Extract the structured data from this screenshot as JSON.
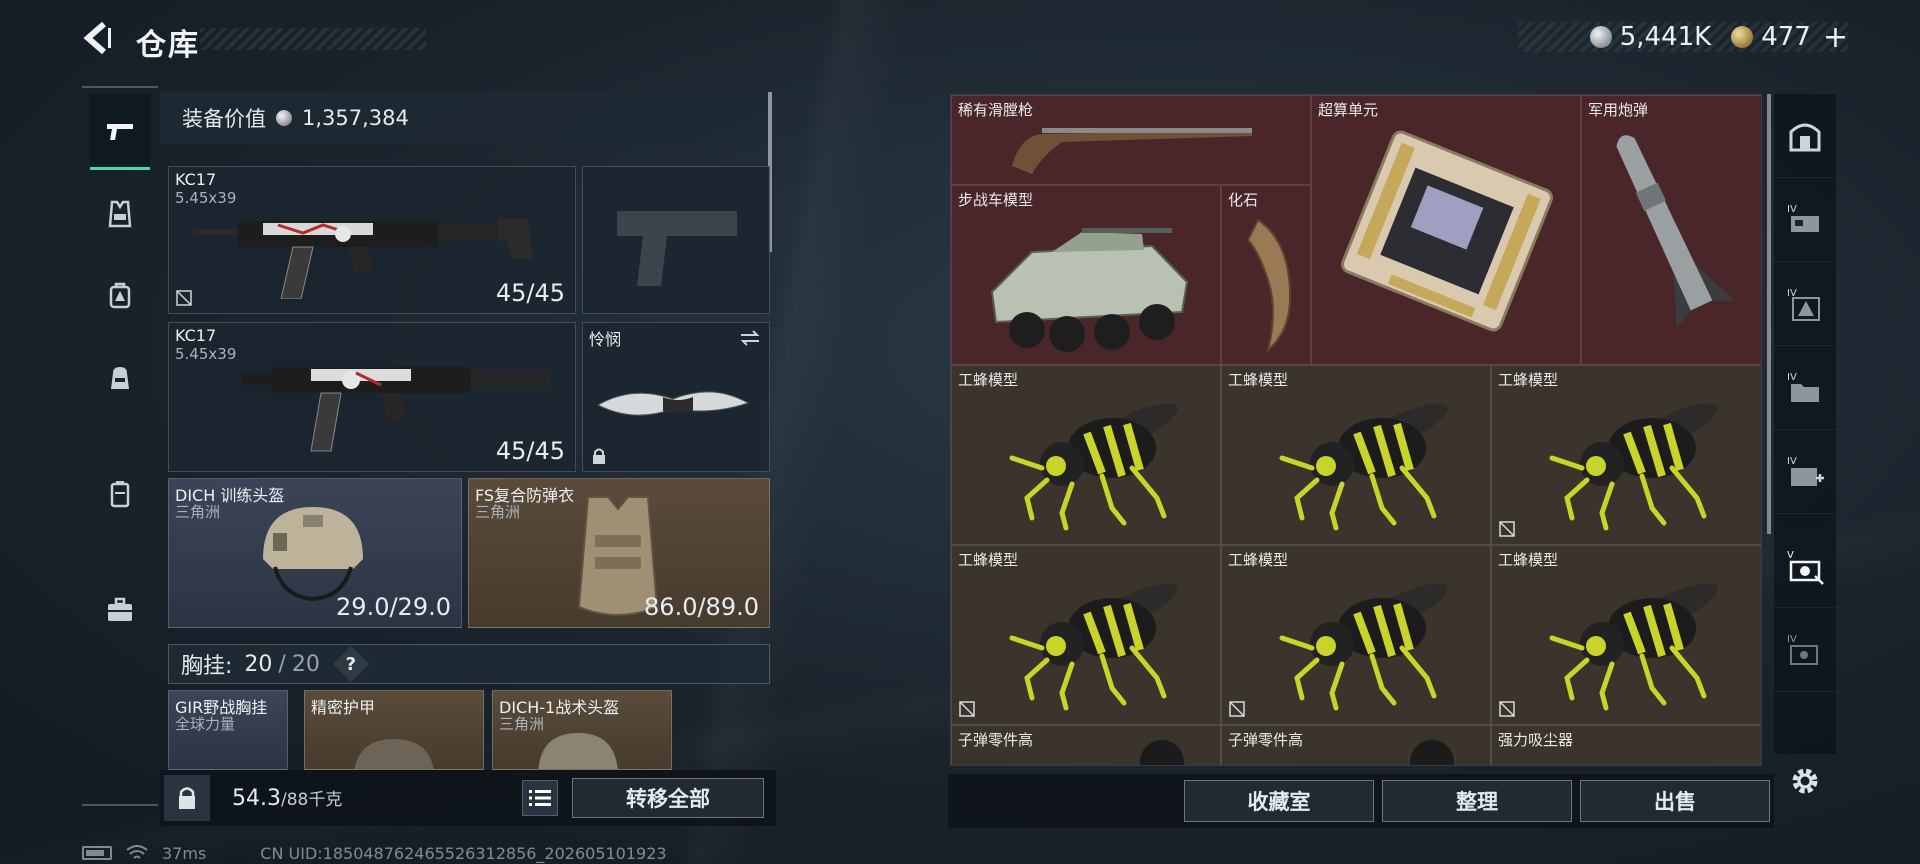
{
  "header": {
    "title": "仓库",
    "currency_silver": "5,441K",
    "currency_gold": "477",
    "add_label": "+"
  },
  "left_nav": {
    "items": [
      "pistol-icon",
      "vest-icon",
      "backpack-lock-icon",
      "pouch-icon",
      "case-icon",
      "toolbox-icon"
    ],
    "active": "pistol-icon"
  },
  "equipment": {
    "value_label": "装备价值",
    "value": "1,357,384",
    "primary_1": {
      "name": "KC17",
      "caliber": "5.45x39",
      "ammo": "45/45"
    },
    "primary_2": {
      "name": "KC17",
      "caliber": "5.45x39",
      "ammo": "45/45"
    },
    "knife": {
      "name": "怜悯"
    },
    "helmet": {
      "name": "DICH 训练头盔",
      "brand": "三角洲",
      "durability": "29.0/29.0"
    },
    "armor": {
      "name": "FS复合防弹衣",
      "brand": "三角洲",
      "durability": "86.0/89.0"
    },
    "rig": {
      "label": "胸挂:",
      "used": "20",
      "sep": "/",
      "capacity": "20",
      "help": "?"
    },
    "rig_items": [
      {
        "name": "GIR野战胸挂",
        "brand": "全球力量"
      },
      {
        "name": "精密护甲",
        "brand": ""
      },
      {
        "name": "DICH-1战术头盔",
        "brand": "三角洲"
      }
    ]
  },
  "bottom_left": {
    "weight_value": "54.3",
    "weight_max": "/88千克",
    "transfer_all": "转移全部"
  },
  "collection": {
    "cells": [
      {
        "id": "shotgun",
        "name": "稀有滑膛枪",
        "color": "red"
      },
      {
        "id": "supercomputer",
        "name": "超算单元",
        "color": "red"
      },
      {
        "id": "shell",
        "name": "军用炮弹",
        "color": "red"
      },
      {
        "id": "ifv",
        "name": "步战车模型",
        "color": "red"
      },
      {
        "id": "fossil",
        "name": "化石",
        "color": "red"
      },
      {
        "id": "bee1",
        "name": "工蜂模型",
        "color": "brown"
      },
      {
        "id": "bee2",
        "name": "工蜂模型",
        "color": "brown"
      },
      {
        "id": "bee3",
        "name": "工蜂模型",
        "color": "brown"
      },
      {
        "id": "bee4",
        "name": "工蜂模型",
        "color": "brown"
      },
      {
        "id": "bee5",
        "name": "工蜂模型",
        "color": "brown"
      },
      {
        "id": "bee6",
        "name": "工蜂模型",
        "color": "brown"
      },
      {
        "id": "parts1",
        "name": "子弹零件高",
        "color": "brown"
      },
      {
        "id": "parts2",
        "name": "子弹零件高",
        "color": "brown"
      },
      {
        "id": "vacuum",
        "name": "强力吸尘器",
        "color": "brown"
      }
    ]
  },
  "right_nav": {
    "items": [
      "safehouse-icon",
      "tier-iv-box-icon",
      "tier-iv-triangle-icon",
      "tier-iv-folder-icon",
      "tier-iv-medkit-icon",
      "tier-v-collection-icon",
      "tier-iv-search-icon"
    ],
    "tier_labels": [
      "IV",
      "IV",
      "IV",
      "IV",
      "V",
      "IV"
    ]
  },
  "actions": {
    "collection_room": "收藏室",
    "sort": "整理",
    "sell": "出售"
  },
  "status": {
    "ping": "37ms",
    "uid": "CN UID:185048762465526312856_202605101923"
  },
  "colors": {
    "accent": "#4ad6b5",
    "red_cell": "#4a262a",
    "brown_cell": "#3a342c",
    "bee_yellow": "#c9d42a"
  }
}
